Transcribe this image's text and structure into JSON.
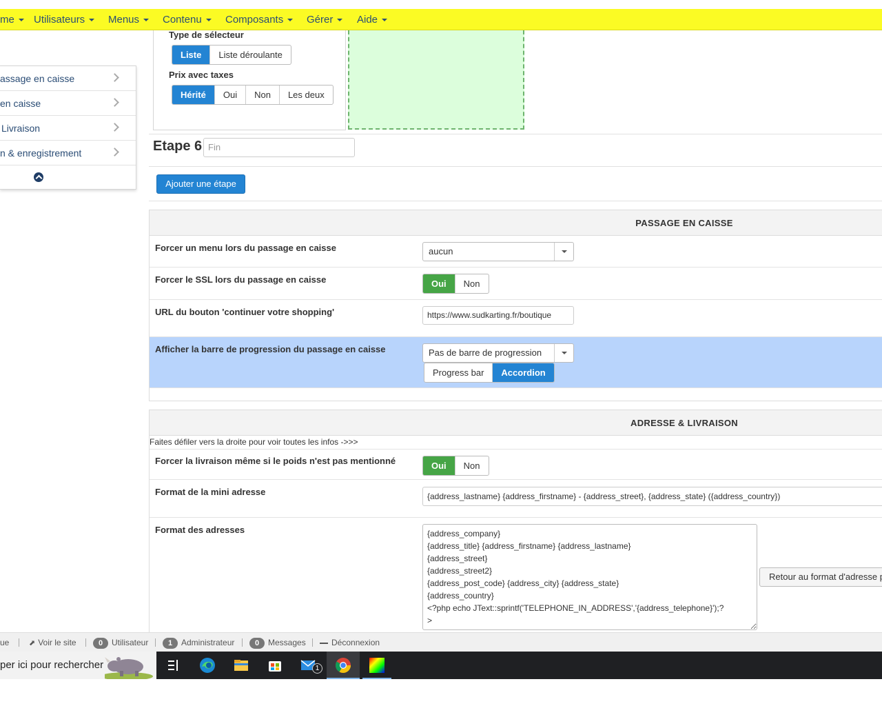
{
  "nav": [
    "me",
    "Utilisateurs",
    "Menus",
    "Contenu",
    "Composants",
    "Gérer",
    "Aide"
  ],
  "side_menu": {
    "items": [
      "assage en caisse",
      "en caisse",
      "Livraison",
      "n & enregistrement"
    ]
  },
  "stage": {
    "selector_label": "Type de sélecteur",
    "selector_options": [
      "Liste",
      "Liste déroulante"
    ],
    "selector_active": "Liste",
    "price_label": "Prix avec taxes",
    "price_options": [
      "Hérité",
      "Oui",
      "Non",
      "Les deux"
    ],
    "price_active": "Hérité",
    "step6_label": "Etape 6",
    "step6_placeholder": "Fin",
    "add_step": "Ajouter une étape"
  },
  "checkout": {
    "title": "PASSAGE EN CAISSE",
    "force_menu_label": "Forcer un menu lors du passage en caisse",
    "force_menu_value": "aucun",
    "force_ssl_label": "Forcer le SSL lors du passage en caisse",
    "yes": "Oui",
    "no": "Non",
    "continue_url_label": "URL du bouton 'continuer votre shopping'",
    "continue_url_value": "https://www.sudkarting.fr/boutique",
    "progress_label": "Afficher la barre de progression du passage en caisse",
    "progress_value": "Pas de barre de progression",
    "progress_options": [
      "Progress bar",
      "Accordion"
    ],
    "progress_active": "Accordion"
  },
  "address": {
    "title": "ADRESSE & LIVRAISON",
    "scroll_hint": "Faites défiler vers la droite pour voir toutes les infos ->>>",
    "force_delivery_label": "Forcer la livraison même si le poids n'est pas mentionné",
    "mini_format_label": "Format de la mini adresse",
    "mini_format_value": "{address_lastname} {address_firstname} - {address_street}, {address_state} ({address_country})",
    "format_label": "Format des adresses",
    "format_value": "{address_company}\n{address_title} {address_firstname} {address_lastname}\n{address_street}\n{address_street2}\n{address_post_code} {address_city} {address_state}\n{address_country}\n<?php echo JText::sprintf('TELEPHONE_IN_ADDRESS','{address_telephone}');?\n>",
    "reset_format": "Retour au format d'adresse p"
  },
  "status": {
    "item0": "ue",
    "view_site": "Voir le site",
    "users_count": "0",
    "users_label": "Utilisateur",
    "admin_count": "1",
    "admin_label": "Administrateur",
    "messages_count": "0",
    "messages_label": "Messages",
    "logout": "Déconnexion"
  },
  "taskbar": {
    "search_text": "per ici pour rechercher",
    "mail_badge": "1"
  }
}
